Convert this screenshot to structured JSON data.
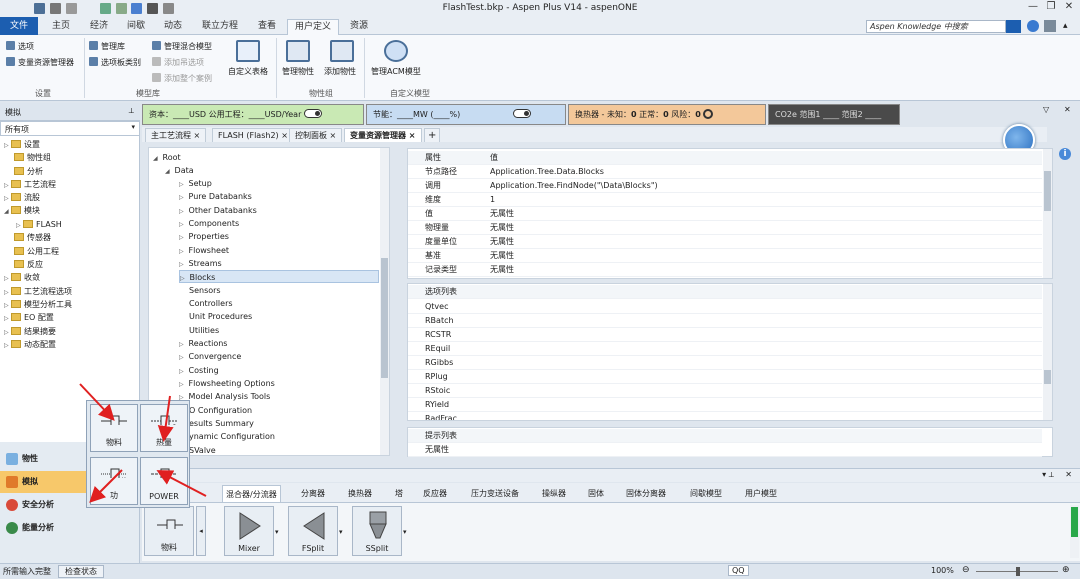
{
  "window": {
    "title": "FlashTest.bkp - Aspen Plus V14 - aspenONE"
  },
  "ribbon_tabs": [
    "文件",
    "主页",
    "经济",
    "间歇",
    "动态",
    "联立方程",
    "查看",
    "用户定义",
    "资源"
  ],
  "active_ribbon_tab": "用户定义",
  "knowledge_search": {
    "placeholder": "Aspen Knowledge 中搜索"
  },
  "ribbon": {
    "settings_group": {
      "label": "设置",
      "items": [
        "选项",
        "变量资源管理器"
      ]
    },
    "model_library_group": {
      "label": "模型库",
      "items": [
        "管理库",
        "选项板类别",
        "管理混合模型",
        "添加吊选项",
        "添加整个案例"
      ]
    },
    "custom_table": "自定义表格",
    "property_group": {
      "label": "物性组",
      "items": [
        "管理物性",
        "添加物性"
      ]
    },
    "eo_group": {
      "label": "自定义模型",
      "items": [
        "管理ACM模型"
      ]
    }
  },
  "info_band": {
    "capital": "资本：",
    "capital_val": "____USD",
    "utility": "公用工程：",
    "utility_val": "____USD/Year",
    "energy": "节能：",
    "energy_val": "____MW",
    "energy_pct": "(____%)",
    "heatx": "换热器 - 未知：",
    "heatx_val": "0",
    "normal": "正常：",
    "normal_val": "0",
    "risk": "风险：",
    "risk_val": "0",
    "co2_1": "CO2e 范围1",
    "co2_1_val": "____",
    "co2_2": "范围2",
    "co2_2_val": "____"
  },
  "nav": {
    "title": "模拟",
    "filter": "所有项",
    "items": [
      "设置",
      "物性组",
      "分析",
      "工艺流程",
      "流股",
      "模块",
      "FLASH",
      "传感器",
      "公用工程",
      "反应",
      "收敛",
      "工艺流程选项",
      "模型分析工具",
      "EO 配置",
      "结果摘要",
      "动态配置"
    ],
    "bottom": [
      "物性",
      "模拟",
      "安全分析",
      "能量分析"
    ]
  },
  "doc_tabs": [
    "主工艺流程",
    "FLASH (Flash2)",
    "控制面板",
    "变量资源管理器"
  ],
  "vtree": {
    "root": "Root",
    "data": "Data",
    "items": [
      "Setup",
      "Pure Databanks",
      "Other Databanks",
      "Components",
      "Properties",
      "Flowsheet",
      "Streams",
      "Blocks",
      "Sensors",
      "Controllers",
      "Unit Procedures",
      "Utilities",
      "Reactions",
      "Convergence",
      "Costing",
      "Flowsheeting Options",
      "Model Analysis Tools",
      "EO Configuration",
      "Results Summary",
      "Dynamic Configuration",
      "CSValve"
    ],
    "items_visible": [
      "Setup",
      "Pure Databanks",
      "Other Databanks",
      "Components",
      "Properties",
      "Flowsheet",
      "Streams",
      "Blocks",
      "Sensors",
      "Controllers",
      "Unit Procedures",
      "Utilities",
      "Reactions",
      "Convergence",
      "Costing",
      "Flowsheeting Options",
      "Model Analysis Tools",
      "O Configuration",
      "esults Summary",
      "ynamic Configuration",
      "SValve"
    ],
    "selected": "Blocks"
  },
  "props": {
    "header": {
      "key": "属性",
      "val": "值"
    },
    "rows": [
      {
        "k": "节点路径",
        "v": "Application.Tree.Data.Blocks"
      },
      {
        "k": "调用",
        "v": "Application.Tree.FindNode(\"\\Data\\Blocks\")"
      },
      {
        "k": "维度",
        "v": "1"
      },
      {
        "k": "值",
        "v": "无属性"
      },
      {
        "k": "物理量",
        "v": "无属性"
      },
      {
        "k": "度量单位",
        "v": "无属性"
      },
      {
        "k": "基准",
        "v": "无属性"
      },
      {
        "k": "记录类型",
        "v": "无属性"
      }
    ]
  },
  "options": {
    "header": "选项列表",
    "items": [
      "Qtvec",
      "RBatch",
      "RCSTR",
      "REquil",
      "RGibbs",
      "RPlug",
      "RStoic",
      "RYield",
      "RadFrac"
    ]
  },
  "hint": {
    "header": "提示列表",
    "value": "无属性"
  },
  "palette": {
    "tabs": [
      "混合器/分流器",
      "分离器",
      "换热器",
      "塔",
      "反应器",
      "压力变送设备",
      "操纵器",
      "固体",
      "固体分离器",
      "间歇模型",
      "用户模型"
    ],
    "active": "混合器/分流器",
    "items": [
      "物料",
      "Mixer",
      "FSplit",
      "SSplit"
    ]
  },
  "popup": {
    "items": [
      "物料",
      "热量",
      "功",
      "POWER"
    ]
  },
  "statusbar": {
    "left": "所需输入完整",
    "check": "检查状态",
    "qq": "QQ",
    "zoom": "100%"
  }
}
